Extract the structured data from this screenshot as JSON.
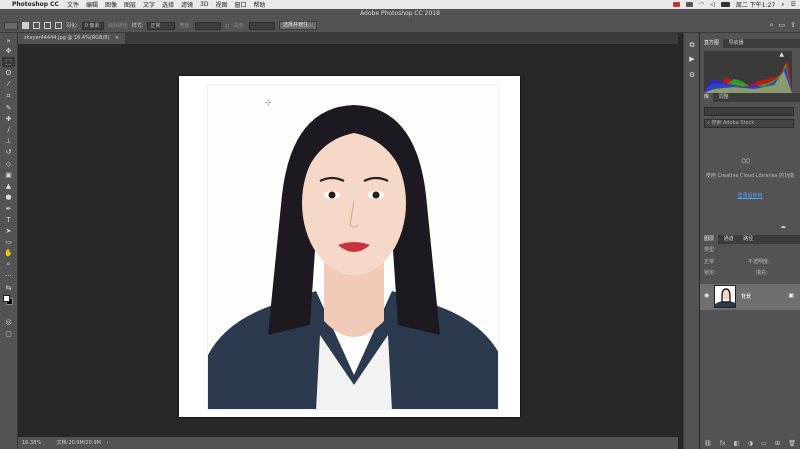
{
  "os_menubar": {
    "apple": "",
    "app_name": "Photoshop CC",
    "menus": [
      "文件",
      "编辑",
      "图像",
      "图层",
      "文字",
      "选择",
      "滤镜",
      "3D",
      "视图",
      "窗口",
      "帮助"
    ],
    "clock": "周二 下午1:27"
  },
  "window": {
    "title": "Adobe Photoshop CC 2018"
  },
  "options_bar": {
    "feather_label": "羽化:",
    "feather_value": "0 像素",
    "antialias_label": "消除锯齿",
    "style_label": "样式:",
    "style_value": "正常",
    "width_label": "宽度:",
    "height_label": "高度:",
    "select_mask_button": "选择并遮住..."
  },
  "document_tab": {
    "label": "zkxyer44444.jpg @ 16.4%(RGB/8)"
  },
  "status_bar": {
    "zoom": "16.38%",
    "doc_info": "文档:20.9M/20.9M"
  },
  "panels": {
    "histogram_tabs": [
      "直方图",
      "导航器"
    ],
    "library_tabs": [
      "库",
      "调整"
    ],
    "library_search_placeholder": "搜索 Adobe Stock",
    "library_message": "使用 Creative Cloud Libraries 的功能",
    "library_link": "登录后使用",
    "layers_tabs": [
      "图层",
      "通道",
      "路径"
    ],
    "layers_kind": "类型",
    "layers_blend": "正常",
    "layers_opacity": "不透明度:",
    "layers_lock": "锁定:",
    "layers_fill": "填充:",
    "layer_name": "背景"
  },
  "colors": {
    "menubar": "#e9e9e9",
    "panel": "#535353",
    "canvas_bg": "#282828",
    "link": "#4aa3ff"
  },
  "icons": {
    "tools": [
      "move-icon",
      "marquee-icon",
      "lasso-icon",
      "quick-select-icon",
      "crop-icon",
      "eyedropper-icon",
      "healing-icon",
      "brush-icon",
      "stamp-icon",
      "history-brush-icon",
      "eraser-icon",
      "gradient-icon",
      "blur-icon",
      "dodge-icon",
      "pen-icon",
      "type-icon",
      "path-select-icon",
      "shape-icon",
      "hand-icon",
      "zoom-icon"
    ]
  }
}
